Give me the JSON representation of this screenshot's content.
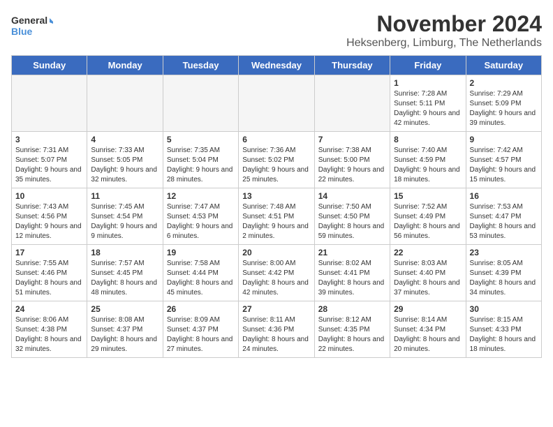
{
  "logo": {
    "line1": "General",
    "line2": "Blue"
  },
  "header": {
    "month_year": "November 2024",
    "location": "Heksenberg, Limburg, The Netherlands"
  },
  "days_of_week": [
    "Sunday",
    "Monday",
    "Tuesday",
    "Wednesday",
    "Thursday",
    "Friday",
    "Saturday"
  ],
  "weeks": [
    [
      {
        "day": "",
        "info": "",
        "empty": true
      },
      {
        "day": "",
        "info": "",
        "empty": true
      },
      {
        "day": "",
        "info": "",
        "empty": true
      },
      {
        "day": "",
        "info": "",
        "empty": true
      },
      {
        "day": "",
        "info": "",
        "empty": true
      },
      {
        "day": "1",
        "info": "Sunrise: 7:28 AM\nSunset: 5:11 PM\nDaylight: 9 hours and 42 minutes.",
        "empty": false
      },
      {
        "day": "2",
        "info": "Sunrise: 7:29 AM\nSunset: 5:09 PM\nDaylight: 9 hours and 39 minutes.",
        "empty": false
      }
    ],
    [
      {
        "day": "3",
        "info": "Sunrise: 7:31 AM\nSunset: 5:07 PM\nDaylight: 9 hours and 35 minutes.",
        "empty": false
      },
      {
        "day": "4",
        "info": "Sunrise: 7:33 AM\nSunset: 5:05 PM\nDaylight: 9 hours and 32 minutes.",
        "empty": false
      },
      {
        "day": "5",
        "info": "Sunrise: 7:35 AM\nSunset: 5:04 PM\nDaylight: 9 hours and 28 minutes.",
        "empty": false
      },
      {
        "day": "6",
        "info": "Sunrise: 7:36 AM\nSunset: 5:02 PM\nDaylight: 9 hours and 25 minutes.",
        "empty": false
      },
      {
        "day": "7",
        "info": "Sunrise: 7:38 AM\nSunset: 5:00 PM\nDaylight: 9 hours and 22 minutes.",
        "empty": false
      },
      {
        "day": "8",
        "info": "Sunrise: 7:40 AM\nSunset: 4:59 PM\nDaylight: 9 hours and 18 minutes.",
        "empty": false
      },
      {
        "day": "9",
        "info": "Sunrise: 7:42 AM\nSunset: 4:57 PM\nDaylight: 9 hours and 15 minutes.",
        "empty": false
      }
    ],
    [
      {
        "day": "10",
        "info": "Sunrise: 7:43 AM\nSunset: 4:56 PM\nDaylight: 9 hours and 12 minutes.",
        "empty": false
      },
      {
        "day": "11",
        "info": "Sunrise: 7:45 AM\nSunset: 4:54 PM\nDaylight: 9 hours and 9 minutes.",
        "empty": false
      },
      {
        "day": "12",
        "info": "Sunrise: 7:47 AM\nSunset: 4:53 PM\nDaylight: 9 hours and 6 minutes.",
        "empty": false
      },
      {
        "day": "13",
        "info": "Sunrise: 7:48 AM\nSunset: 4:51 PM\nDaylight: 9 hours and 2 minutes.",
        "empty": false
      },
      {
        "day": "14",
        "info": "Sunrise: 7:50 AM\nSunset: 4:50 PM\nDaylight: 8 hours and 59 minutes.",
        "empty": false
      },
      {
        "day": "15",
        "info": "Sunrise: 7:52 AM\nSunset: 4:49 PM\nDaylight: 8 hours and 56 minutes.",
        "empty": false
      },
      {
        "day": "16",
        "info": "Sunrise: 7:53 AM\nSunset: 4:47 PM\nDaylight: 8 hours and 53 minutes.",
        "empty": false
      }
    ],
    [
      {
        "day": "17",
        "info": "Sunrise: 7:55 AM\nSunset: 4:46 PM\nDaylight: 8 hours and 51 minutes.",
        "empty": false
      },
      {
        "day": "18",
        "info": "Sunrise: 7:57 AM\nSunset: 4:45 PM\nDaylight: 8 hours and 48 minutes.",
        "empty": false
      },
      {
        "day": "19",
        "info": "Sunrise: 7:58 AM\nSunset: 4:44 PM\nDaylight: 8 hours and 45 minutes.",
        "empty": false
      },
      {
        "day": "20",
        "info": "Sunrise: 8:00 AM\nSunset: 4:42 PM\nDaylight: 8 hours and 42 minutes.",
        "empty": false
      },
      {
        "day": "21",
        "info": "Sunrise: 8:02 AM\nSunset: 4:41 PM\nDaylight: 8 hours and 39 minutes.",
        "empty": false
      },
      {
        "day": "22",
        "info": "Sunrise: 8:03 AM\nSunset: 4:40 PM\nDaylight: 8 hours and 37 minutes.",
        "empty": false
      },
      {
        "day": "23",
        "info": "Sunrise: 8:05 AM\nSunset: 4:39 PM\nDaylight: 8 hours and 34 minutes.",
        "empty": false
      }
    ],
    [
      {
        "day": "24",
        "info": "Sunrise: 8:06 AM\nSunset: 4:38 PM\nDaylight: 8 hours and 32 minutes.",
        "empty": false
      },
      {
        "day": "25",
        "info": "Sunrise: 8:08 AM\nSunset: 4:37 PM\nDaylight: 8 hours and 29 minutes.",
        "empty": false
      },
      {
        "day": "26",
        "info": "Sunrise: 8:09 AM\nSunset: 4:37 PM\nDaylight: 8 hours and 27 minutes.",
        "empty": false
      },
      {
        "day": "27",
        "info": "Sunrise: 8:11 AM\nSunset: 4:36 PM\nDaylight: 8 hours and 24 minutes.",
        "empty": false
      },
      {
        "day": "28",
        "info": "Sunrise: 8:12 AM\nSunset: 4:35 PM\nDaylight: 8 hours and 22 minutes.",
        "empty": false
      },
      {
        "day": "29",
        "info": "Sunrise: 8:14 AM\nSunset: 4:34 PM\nDaylight: 8 hours and 20 minutes.",
        "empty": false
      },
      {
        "day": "30",
        "info": "Sunrise: 8:15 AM\nSunset: 4:33 PM\nDaylight: 8 hours and 18 minutes.",
        "empty": false
      }
    ]
  ]
}
